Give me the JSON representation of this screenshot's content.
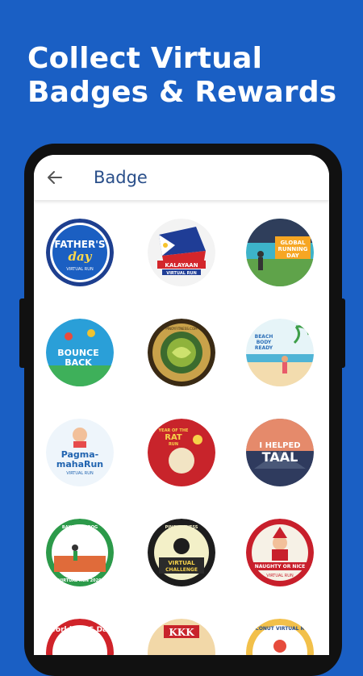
{
  "promo": {
    "headline_line1": "Collect Virtual",
    "headline_line2": "Badges & Rewards"
  },
  "appbar": {
    "title": "Badge",
    "back_icon": "arrow-back-icon"
  },
  "badges": [
    {
      "id": "fathers-day",
      "text1": "FATHER'S",
      "text2": "day",
      "text3": "VIRTUAL RUN"
    },
    {
      "id": "kalayaan",
      "text1": "KALAYAAN",
      "text2": "VIRTUAL RUN"
    },
    {
      "id": "global-running-day",
      "text1": "GLOBAL",
      "text2": "RUNNING",
      "text3": "DAY"
    },
    {
      "id": "bounce-back",
      "text1": "BOUNCE",
      "text2": "BACK"
    },
    {
      "id": "pinoy-fitness-medal",
      "text1": "PINOYFITNESS.COM"
    },
    {
      "id": "beach-body-ready",
      "text1": "BEACH",
      "text2": "BODY",
      "text3": "READY"
    },
    {
      "id": "pagmamaharun",
      "text1": "Pagma-",
      "text2": "mahaRun",
      "text3": "VIRTUAL RUN"
    },
    {
      "id": "year-of-the-rat",
      "text1": "YEAR OF THE",
      "text2": "RAT",
      "text3": "RUN"
    },
    {
      "id": "i-helped-taal",
      "text1": "I HELPED",
      "text2": "TAAL"
    },
    {
      "id": "bakit-alindog",
      "text1": "BAKIT ALINDOG",
      "text2": "VIRTUAL RUN 2020"
    },
    {
      "id": "virtual-challenge",
      "text1": "PINOYFITNESS",
      "text2": "VIRTUAL",
      "text3": "CHALLENGE"
    },
    {
      "id": "naughty-or-nice",
      "text1": "NAUGHTY OR NICE",
      "text2": "VIRTUAL RUN"
    },
    {
      "id": "world-aids-day",
      "text1": "World AIDS Day"
    },
    {
      "id": "kkk",
      "text1": "KKK"
    },
    {
      "id": "coconut-virtual-run",
      "text1": "COCONUT VIRTUAL RUN"
    }
  ]
}
